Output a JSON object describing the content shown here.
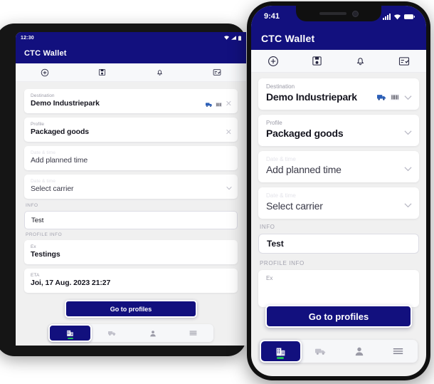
{
  "app": {
    "name": "CTC Wallet",
    "brand_navy": "#12107e",
    "accent_green": "#1dbf55",
    "screen_bg": "#f0f0f0"
  },
  "tablet": {
    "status_time": "12:30",
    "status_icons": [
      "wifi-icon",
      "signal-icon",
      "battery-icon"
    ],
    "appbar_title": "CTC Wallet",
    "toolbar": [
      {
        "name": "add-circle-icon",
        "label": "Add"
      },
      {
        "name": "save-icon",
        "label": "Save"
      },
      {
        "name": "bell-icon",
        "label": "Notifications"
      },
      {
        "name": "task-list-icon",
        "label": "Tasks"
      }
    ],
    "fields": [
      {
        "label": "Destination",
        "value": "Demo Industriepark",
        "faint_label": false,
        "bold": true,
        "trailing": [
          "truck-icon",
          "barcode-icon",
          "clear-icon"
        ]
      },
      {
        "label": "Profile",
        "value": "Packaged goods",
        "faint_label": false,
        "bold": true,
        "trailing": [
          "clear-icon"
        ]
      },
      {
        "label": "Date & time",
        "value": "Add planned time",
        "faint_label": true,
        "bold": false,
        "trailing": []
      },
      {
        "label": "Date & time",
        "value": "Select carrier",
        "faint_label": true,
        "bold": false,
        "trailing": [
          "chevron-down-icon"
        ]
      }
    ],
    "info_section": "INFO",
    "info_value": "Test",
    "profile_section": "PROFILE INFO",
    "profile_fields": [
      {
        "label": "Ex",
        "value": "Testings"
      },
      {
        "label": "ETA",
        "value": "Joi, 17 Aug. 2023 21:27"
      }
    ],
    "primary_button": "Go to profiles",
    "nav": [
      {
        "name": "building-icon",
        "label": "Sites",
        "active": true
      },
      {
        "name": "truck-icon",
        "label": "Transports",
        "active": false
      },
      {
        "name": "person-icon",
        "label": "Profile",
        "active": false
      },
      {
        "name": "menu-icon",
        "label": "More",
        "active": false
      }
    ]
  },
  "phone": {
    "status_time": "9:41",
    "status_icons": [
      "signal-icon",
      "wifi-icon",
      "battery-icon"
    ],
    "appbar_title": "CTC Wallet",
    "toolbar": [
      {
        "name": "add-circle-icon",
        "label": "Add"
      },
      {
        "name": "save-icon",
        "label": "Save"
      },
      {
        "name": "bell-icon",
        "label": "Notifications"
      },
      {
        "name": "task-list-icon",
        "label": "Tasks"
      }
    ],
    "fields": [
      {
        "label": "Destination",
        "value": "Demo Industriepark",
        "faint_label": false,
        "bold": true,
        "trailing": [
          "truck-icon",
          "barcode-icon",
          "chevron-down-icon"
        ]
      },
      {
        "label": "Profile",
        "value": "Packaged goods",
        "faint_label": false,
        "bold": true,
        "trailing": [
          "chevron-down-icon"
        ]
      },
      {
        "label": "Date & time",
        "value": "Add planned time",
        "faint_label": true,
        "bold": false,
        "trailing": [
          "chevron-down-icon"
        ]
      },
      {
        "label": "Date & time",
        "value": "Select carrier",
        "faint_label": true,
        "bold": false,
        "trailing": [
          "chevron-down-icon"
        ]
      }
    ],
    "info_section": "INFO",
    "info_value": "Test",
    "profile_section": "PROFILE INFO",
    "profile_fields": [
      {
        "label": "Ex",
        "value": ""
      }
    ],
    "primary_button": "Go to profiles",
    "nav": [
      {
        "name": "building-icon",
        "label": "Sites",
        "active": true
      },
      {
        "name": "truck-icon",
        "label": "Transports",
        "active": false
      },
      {
        "name": "person-icon",
        "label": "Profile",
        "active": false
      },
      {
        "name": "menu-icon",
        "label": "More",
        "active": false
      }
    ]
  }
}
